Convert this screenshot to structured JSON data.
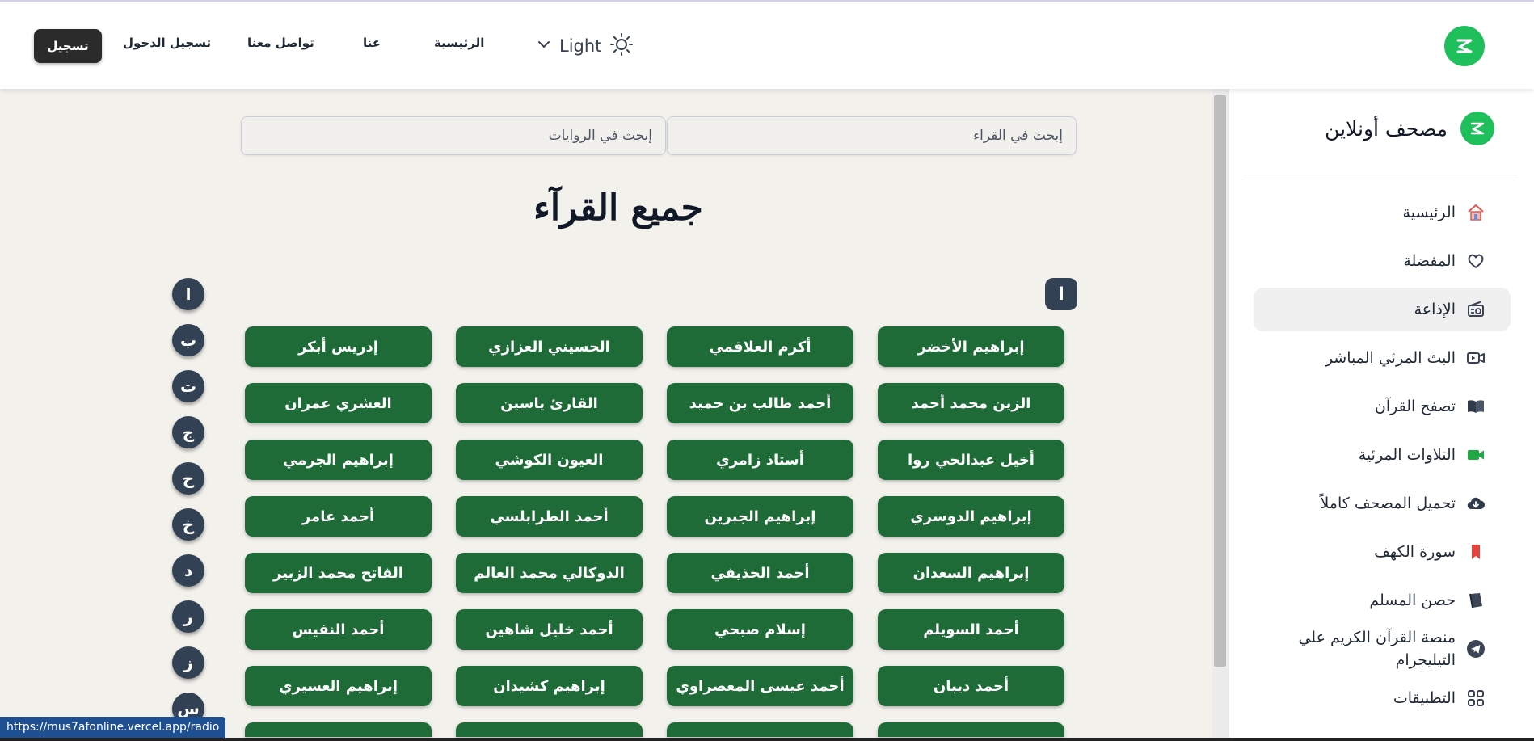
{
  "header": {
    "signup_label": "تسجيل",
    "login_label": "تسجيل الدخول",
    "contact_label": "تواصل معنا",
    "about_label": "عنا",
    "home_label": "الرئيسية",
    "theme_label": "Light"
  },
  "sidebar": {
    "title": "مصحف أونلاين",
    "items": [
      {
        "label": "الرئيسية",
        "icon": "home-icon",
        "active": false
      },
      {
        "label": "المفضلة",
        "icon": "heart-icon",
        "active": false
      },
      {
        "label": "الإذاعة",
        "icon": "radio-icon",
        "active": true
      },
      {
        "label": "البث المرئي المباشر",
        "icon": "live-video-icon",
        "active": false
      },
      {
        "label": "تصفح القرآن",
        "icon": "book-open-icon",
        "active": false
      },
      {
        "label": "التلاوات المرئية",
        "icon": "video-camera-icon",
        "active": false
      },
      {
        "label": "تحميل المصحف كاملاً",
        "icon": "cloud-download-icon",
        "active": false
      },
      {
        "label": "سورة الكهف",
        "icon": "bookmark-icon",
        "active": false
      },
      {
        "label": "حصن المسلم",
        "icon": "book-icon",
        "active": false
      },
      {
        "label": "منصة القرآن الكريم علي التيليجرام",
        "icon": "telegram-icon",
        "active": false
      },
      {
        "label": "التطبيقات",
        "icon": "apps-grid-icon",
        "active": false
      }
    ]
  },
  "main": {
    "search_reciters_placeholder": "إبحث في القراء",
    "search_narrations_placeholder": "إبحث في الروايات",
    "page_title": "جميع القرآء",
    "section_letter": "ا",
    "letters": [
      "ا",
      "ب",
      "ت",
      "ج",
      "ح",
      "خ",
      "د",
      "ر",
      "ز",
      "س"
    ],
    "reciters": [
      [
        "إبراهيم الأخضر",
        "أكرم العلاقمي",
        "الحسيني العزازي",
        "إدريس أبكر"
      ],
      [
        "الزين محمد أحمد",
        "أحمد طالب بن حميد",
        "القارئ ياسين",
        "العشري عمران"
      ],
      [
        "أخيل عبدالحي روا",
        "أستاذ زامري",
        "العيون الكوشي",
        "إبراهيم الجرمي"
      ],
      [
        "إبراهيم الدوسري",
        "إبراهيم الجبرين",
        "أحمد الطرابلسي",
        "أحمد عامر"
      ],
      [
        "إبراهيم السعدان",
        "أحمد الحذيفي",
        "الدوكالي محمد العالم",
        "الفاتح محمد الزبير"
      ],
      [
        "أحمد السويلم",
        "إسلام صبحي",
        "أحمد خليل شاهين",
        "أحمد النفيس"
      ],
      [
        "أحمد ديبان",
        "أحمد عيسى المعصراوي",
        "إبراهيم كشيدان",
        "إبراهيم العسيري"
      ]
    ]
  },
  "status_url": "https://mus7afonline.vercel.app/radio",
  "colors": {
    "accent_green": "#1fbf5c",
    "reciter_button": "#1e6b38",
    "letter_button": "#334155",
    "background": "#f3f1ec"
  }
}
